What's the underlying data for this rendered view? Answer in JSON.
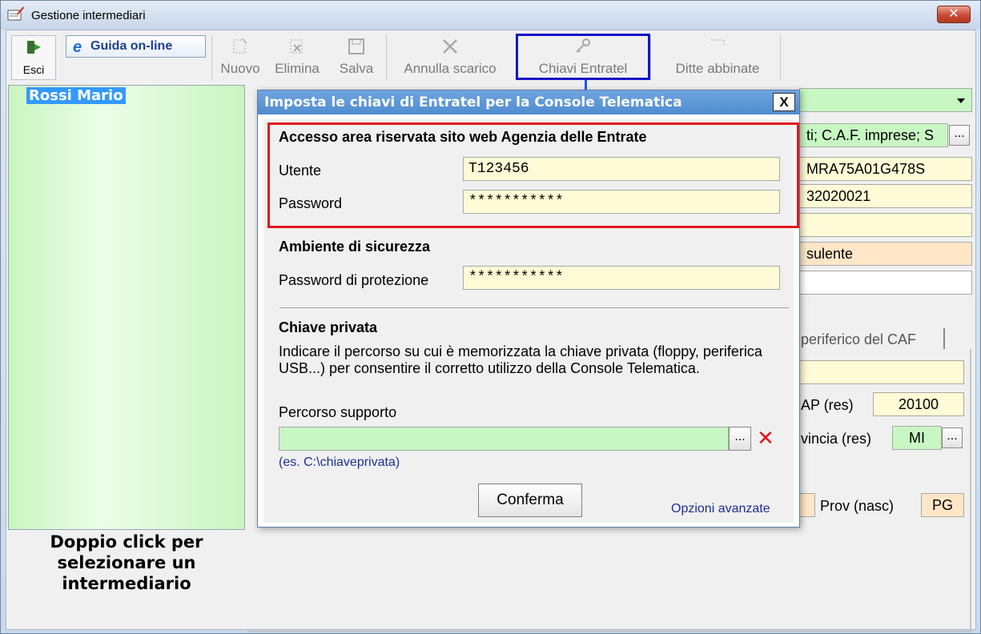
{
  "window": {
    "title": "Gestione intermediari",
    "close_label": "✕"
  },
  "toolbar": {
    "esci": "Esci",
    "guida": "Guida on-line",
    "nuovo": "Nuovo",
    "elimina": "Elimina",
    "salva": "Salva",
    "annulla": "Annulla scarico",
    "chiavi": "Chiavi Entratel",
    "ditte": "Ditte abbinate"
  },
  "list": {
    "selected": "Rossi  Mario",
    "hint": "Doppio click per selezionare un intermediario"
  },
  "background_form": {
    "category_text": "ti; C.A.F. imprese; S",
    "codice_fiscale": "MRA75A01G478S",
    "number": "32020021",
    "role": "sulente",
    "tab_label": "periferico del CAF",
    "cap_label": "AP (res)",
    "cap_value": "20100",
    "prov_res_label": "vincia (res)",
    "prov_res_value": "MI",
    "prov_nasc_label": "Prov (nasc)",
    "prov_nasc_value": "PG",
    "dots": "..."
  },
  "dialog": {
    "title": "Imposta le chiavi di Entratel per la Console Telematica",
    "close": "X",
    "section1_title": "Accesso area riservata sito web Agenzia delle Entrate",
    "utente_label": "Utente",
    "utente_value": "T123456",
    "password_label": "Password",
    "password_value": "***********",
    "section2_title": "Ambiente di sicurezza",
    "prot_label": "Password di protezione",
    "prot_value": "***********",
    "section3_title": "Chiave privata",
    "description": "Indicare il percorso su cui è memorizzata la chiave privata (floppy, periferica USB...) per consentire il corretto utilizzo della Console Telematica.",
    "percorso_label": "Percorso supporto",
    "percorso_value": "",
    "dots": "...",
    "example": "(es. C:\\chiaveprivata)",
    "confirm": "Conferma",
    "advanced": "Opzioni avanzate"
  },
  "colors": {
    "highlight_blue": "#1414c8",
    "highlight_red": "#e3171c",
    "dialog_title": "#5b95d6",
    "field_yellow": "#fffbd6",
    "field_green": "#c8f7c3"
  }
}
